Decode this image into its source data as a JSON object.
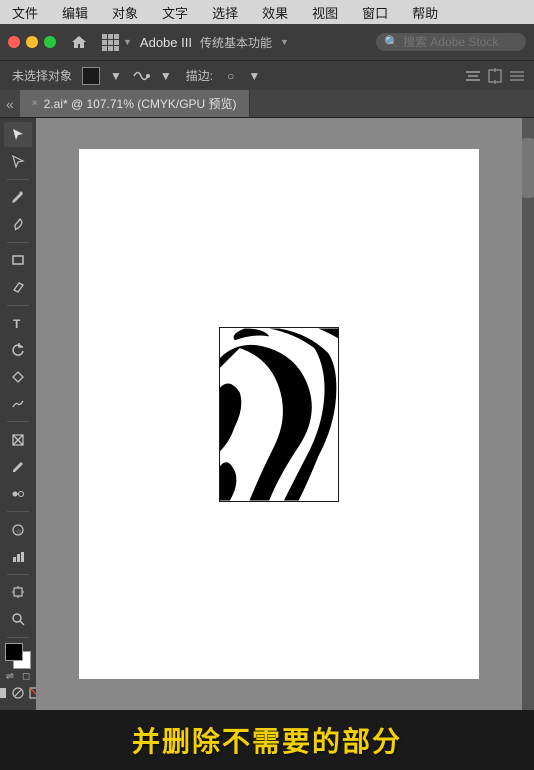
{
  "menubar": {
    "items": [
      "文件",
      "编辑",
      "对象",
      "文字",
      "选择",
      "效果",
      "视图",
      "窗口",
      "帮助"
    ]
  },
  "toolbar1": {
    "workspace_name": "Adobe III",
    "workspace_preset": "传统基本功能",
    "search_placeholder": "搜索 Adobe Stock"
  },
  "toolbar2": {
    "selection_label": "未选择对象",
    "stroke_label": "描边:",
    "stroke_value": "○"
  },
  "tabs": {
    "active_tab": "2.ai* @ 107.71% (CMYK/GPU 预览)",
    "close_symbol": "×"
  },
  "tools": {
    "items": [
      {
        "name": "selection-tool",
        "symbol": "↖"
      },
      {
        "name": "direct-select-tool",
        "symbol": "⬡"
      },
      {
        "name": "pen-tool",
        "symbol": "✒"
      },
      {
        "name": "calligraphy-tool",
        "symbol": "✏"
      },
      {
        "name": "rectangle-tool",
        "symbol": "▭"
      },
      {
        "name": "eraser-tool",
        "symbol": "◻"
      },
      {
        "name": "type-tool",
        "symbol": "T"
      },
      {
        "name": "rotate-tool",
        "symbol": "↻"
      },
      {
        "name": "shape-tool",
        "symbol": "◇"
      },
      {
        "name": "scale-tool",
        "symbol": "⤢"
      },
      {
        "name": "warp-tool",
        "symbol": "〜"
      },
      {
        "name": "rectangle-frame-tool",
        "symbol": "⊡"
      },
      {
        "name": "eyedropper-tool",
        "symbol": "🖉"
      },
      {
        "name": "blend-tool",
        "symbol": "⊕"
      },
      {
        "name": "symbol-tool",
        "symbol": "⊛"
      },
      {
        "name": "column-graph-tool",
        "symbol": "📊"
      },
      {
        "name": "artboard-tool",
        "symbol": "⊞"
      },
      {
        "name": "zoom-tool",
        "symbol": "🔍"
      },
      {
        "name": "hand-tool",
        "symbol": "✋"
      }
    ]
  },
  "subtitle": {
    "text": "并删除不需要的部分"
  }
}
